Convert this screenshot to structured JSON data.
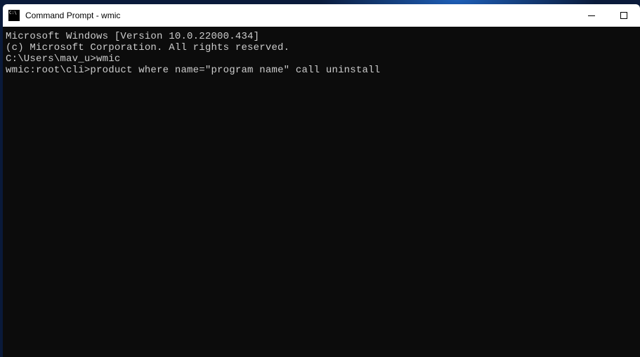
{
  "titlebar": {
    "title": "Command Prompt - wmic"
  },
  "terminal": {
    "line1": "Microsoft Windows [Version 10.0.22000.434]",
    "line2": "(c) Microsoft Corporation. All rights reserved.",
    "blank1": "",
    "prompt1_prefix": "C:\\Users\\mav_u>",
    "prompt1_cmd": "wmic",
    "prompt2_prefix": "wmic:root\\cli>",
    "prompt2_cmd": "product where name=\"program name\" call uninstall"
  }
}
